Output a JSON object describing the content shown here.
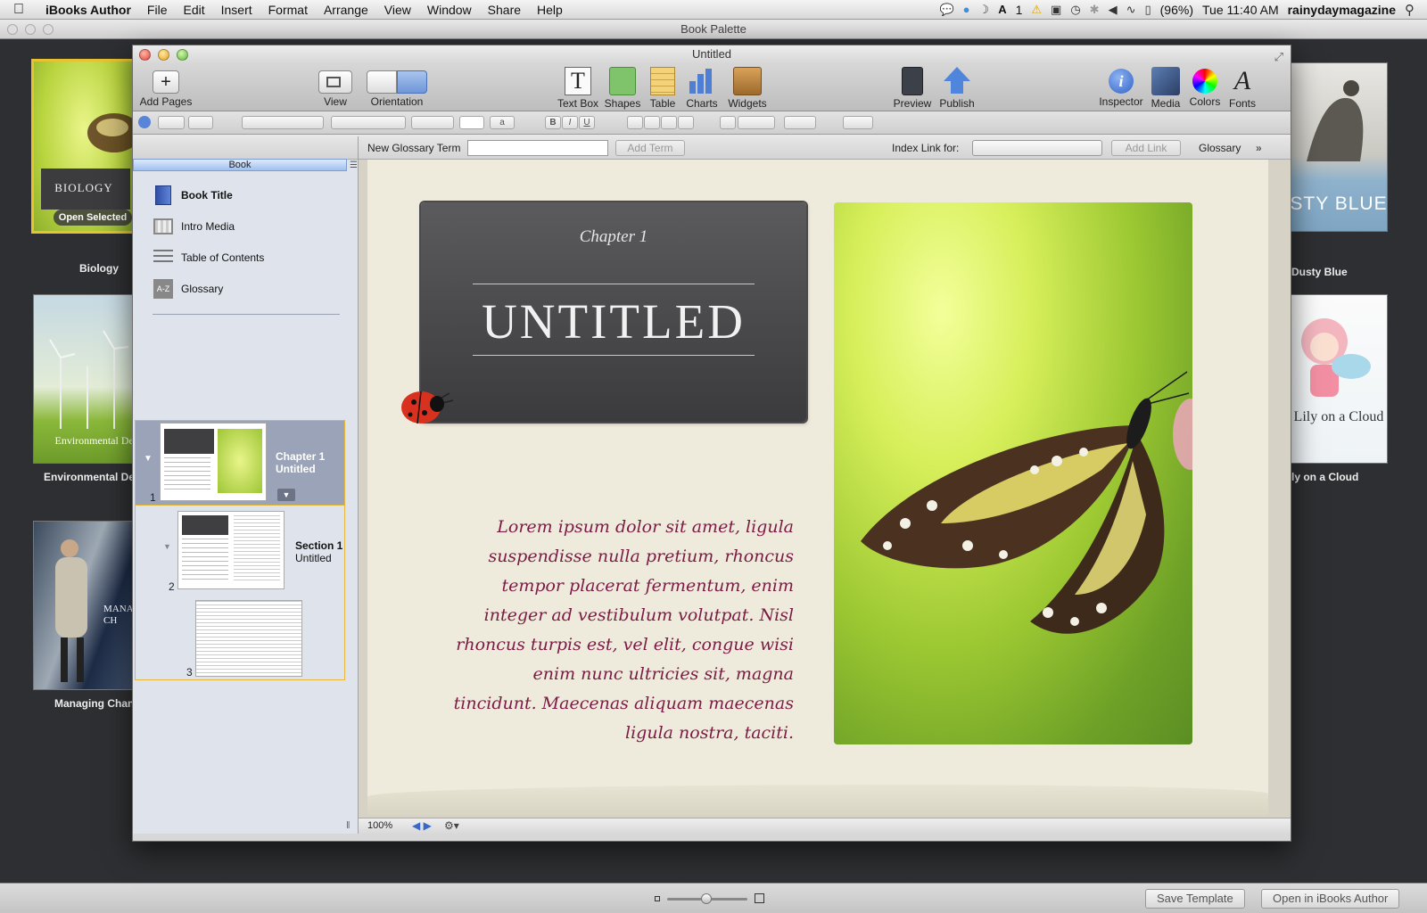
{
  "menubar": {
    "items": [
      "iBooks Author",
      "File",
      "Edit",
      "Insert",
      "Format",
      "Arrange",
      "View",
      "Window",
      "Share",
      "Help"
    ],
    "badge_count": "1",
    "battery": "(96%)",
    "clock": "Tue 11:40 AM",
    "user": "rainydaymagazine"
  },
  "palette": {
    "title": "Book Palette",
    "open_selected": "Open Selected",
    "save_template": "Save Template",
    "open_in_app": "Open in iBooks Author",
    "templates": [
      {
        "name": "Biology",
        "cover_title": "BIOLOGY"
      },
      {
        "name": "Environmental De",
        "cover_title": "Environmental Des"
      },
      {
        "name": "Managing Chan",
        "cover_title": "MANA CH"
      },
      {
        "name": "Dusty Blue",
        "cover_title": "STY BLUE"
      },
      {
        "name": "ly on a Cloud",
        "cover_title": "Lily on a Cloud"
      }
    ]
  },
  "doc": {
    "title": "Untitled",
    "toolbar": {
      "add_pages": "Add Pages",
      "view": "View",
      "orientation": "Orientation",
      "text_box": "Text Box",
      "shapes": "Shapes",
      "table": "Table",
      "charts": "Charts",
      "widgets": "Widgets",
      "preview": "Preview",
      "publish": "Publish",
      "inspector": "Inspector",
      "media": "Media",
      "colors": "Colors",
      "fonts": "Fonts"
    },
    "format": {
      "bold": "B",
      "italic": "I",
      "underline": "U",
      "letter_a": "a"
    },
    "glossary": {
      "new_term_label": "New Glossary Term",
      "add_term": "Add Term",
      "index_link_label": "Index Link for:",
      "add_link": "Add Link",
      "glossary_label": "Glossary"
    },
    "sidebar": {
      "header": "Book",
      "items": [
        {
          "label": "Book Title"
        },
        {
          "label": "Intro Media"
        },
        {
          "label": "Table of Contents"
        },
        {
          "label": "Glossary"
        }
      ],
      "glossary_icon_text": "A-Z",
      "chapter": {
        "line1": "Chapter 1",
        "line2": "Untitled",
        "page": "1"
      },
      "section": {
        "line1": "Section 1",
        "line2": "Untitled",
        "page": "2"
      },
      "page3": {
        "page": "3"
      }
    },
    "canvas": {
      "chapter_label": "Chapter 1",
      "title": "UNTITLED",
      "body_text": "Lorem ipsum dolor sit amet, ligula suspendisse nulla pretium, rhoncus tempor placerat fermentum, enim integer ad vestibulum volutpat. Nisl rhoncus turpis est, vel elit, congue wisi enim nunc ultricies sit, magna tincidunt. Maecenas aliquam maecenas ligula nostra, taciti."
    },
    "status": {
      "zoom": "100%"
    }
  },
  "colors": {
    "selection_border": "#e6b73b",
    "body_text": "#7b1a45",
    "title_card": "#4a4a4c"
  }
}
